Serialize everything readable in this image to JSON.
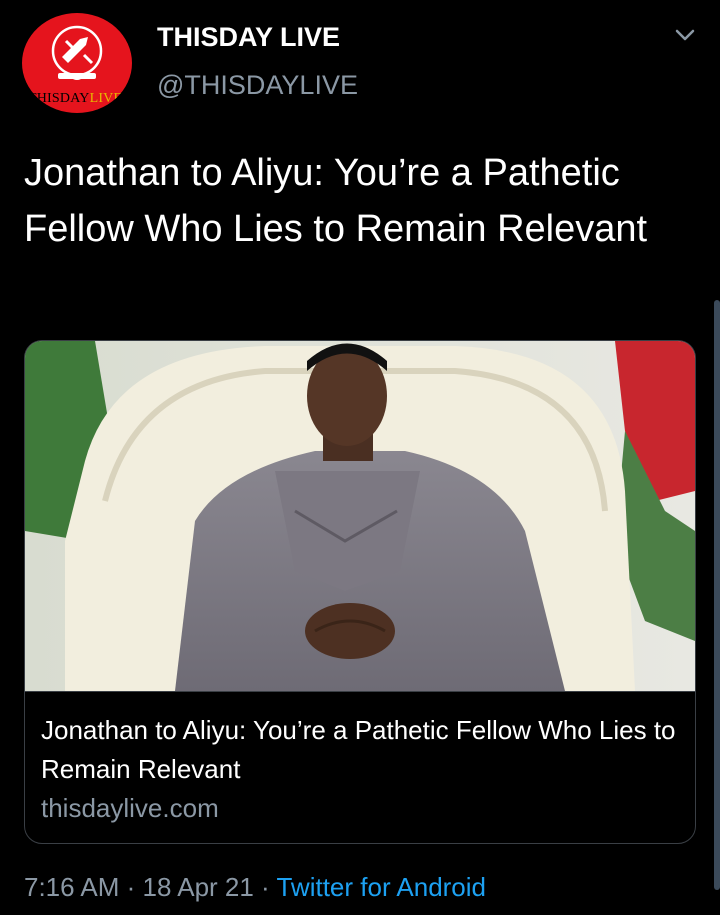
{
  "author": {
    "display_name": "THISDAY LIVE",
    "handle": "@THISDAYLIVE",
    "avatar_text_main": "THISDAY",
    "avatar_text_accent": "LIVE"
  },
  "tweet": {
    "text": "Jonathan to Aliyu: You’re a Pathetic Fellow Who Lies to Remain Relevant"
  },
  "card": {
    "title": "Jonathan to Aliyu: You’re a Pathetic Fellow Who Lies to Remain Relevant",
    "domain": "thisdaylive.com",
    "image_icon": "photo-man-seated-in-white-chair"
  },
  "meta": {
    "time": "7:16 AM",
    "separator1": " · ",
    "date": "18 Apr 21",
    "separator2": " · ",
    "source": "Twitter for Android"
  },
  "icons": {
    "menu": "chevron-down-icon"
  },
  "colors": {
    "background": "#000000",
    "brand_red": "#e5141d",
    "secondary_text": "#8b98a5",
    "link_blue": "#1da1f2"
  }
}
